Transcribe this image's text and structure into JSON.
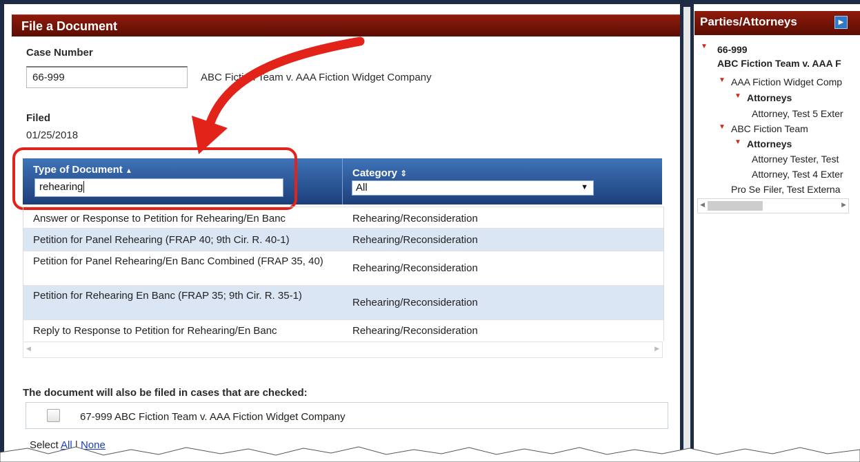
{
  "main": {
    "title": "File a Document",
    "case_number_label": "Case Number",
    "case_number_value": "66-999",
    "case_name": "ABC Fiction Team v. AAA Fiction Widget Company",
    "filed_label": "Filed",
    "filed_date": "01/25/2018",
    "grid": {
      "col1_title": "Type of Document",
      "col1_sort_icon": "sort-asc-icon",
      "col1_filter_value": "rehearing",
      "col2_title": "Category",
      "col2_sort_icon": "sort-both-icon",
      "col2_filter_selected": "All",
      "rows": [
        {
          "type": "Answer or Response to Petition for Rehearing/En Banc",
          "category": "Rehearing/Reconsideration"
        },
        {
          "type": "Petition for Panel Rehearing (FRAP 40; 9th Cir. R. 40-1)",
          "category": "Rehearing/Reconsideration"
        },
        {
          "type": "Petition for Panel Rehearing/En Banc Combined (FRAP 35, 40)",
          "category": "Rehearing/Reconsideration"
        },
        {
          "type": "Petition for Rehearing En Banc (FRAP 35; 9th Cir. R. 35-1)",
          "category": "Rehearing/Reconsideration"
        },
        {
          "type": "Reply to Response to Petition for Rehearing/En Banc",
          "category": "Rehearing/Reconsideration"
        }
      ]
    },
    "also_filed_label": "The document will also be filed in cases that are checked:",
    "also_filed_case": "67-999 ABC Fiction Team v. AAA Fiction Widget Company",
    "select_prefix": "Select",
    "select_all": "All",
    "select_separator": "|",
    "select_none": "None"
  },
  "side": {
    "title": "Parties/Attorneys",
    "toggle_icon": "collapse-right-icon",
    "case_number": "66-999",
    "case_name": "ABC Fiction Team v. AAA F",
    "party1": "AAA Fiction Widget Comp",
    "party1_attorneys_label": "Attorneys",
    "party1_attorney1": "Attorney, Test 5 Exter",
    "party2": "ABC Fiction Team",
    "party2_attorneys_label": "Attorneys",
    "party2_attorney1": "Attorney Tester, Test",
    "party2_attorney2": "Attorney, Test 4 Exter",
    "pro_se": "Pro Se Filer, Test Externa"
  },
  "colors": {
    "header_red": "#7a1408",
    "grid_blue": "#2a5599",
    "highlight_red": "#e2231a",
    "row_alt": "#dbe6f4",
    "link_blue": "#1a3cc7"
  }
}
